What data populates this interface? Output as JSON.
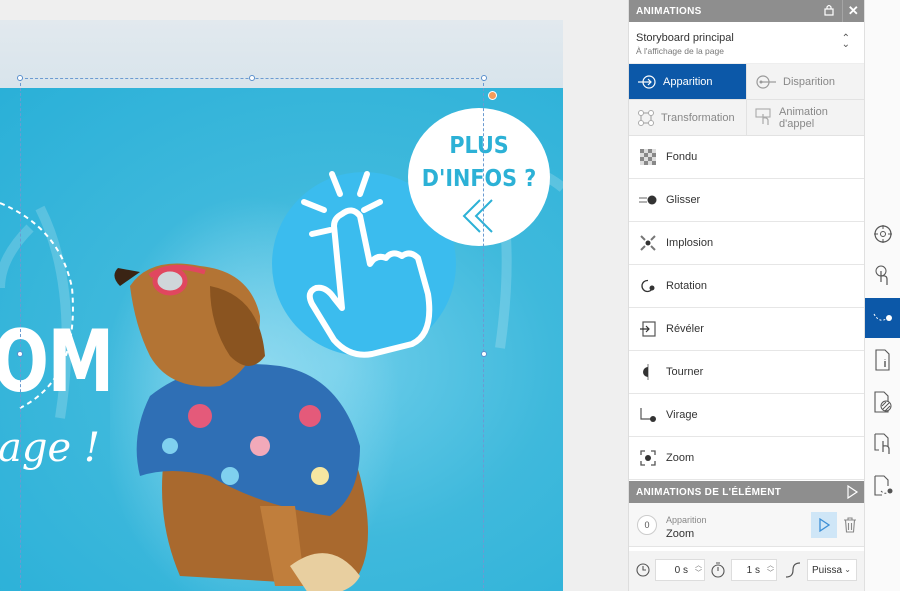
{
  "canvas": {
    "headline": "OM",
    "script_line": "age !",
    "info_bubble": {
      "line1": "PLUS",
      "line2": "D'INFOS ?"
    }
  },
  "panel": {
    "title": "ANIMATIONS",
    "storyboard": {
      "name": "Storyboard principal",
      "trigger": "À l'affichage de la page"
    },
    "tabs": [
      {
        "label": "Apparition",
        "active": true
      },
      {
        "label": "Disparition",
        "active": false
      },
      {
        "label": "Transformation",
        "active": false
      },
      {
        "label_line1": "Animation",
        "label_line2": "d'appel",
        "active": false
      }
    ],
    "animations": [
      "Fondu",
      "Glisser",
      "Implosion",
      "Rotation",
      "Révéler",
      "Tourner",
      "Virage",
      "Zoom"
    ],
    "element_section": {
      "title": "ANIMATIONS DE L'ÉLÉMENT",
      "item": {
        "index": "0",
        "type": "Apparition",
        "name": "Zoom"
      },
      "delay": "0 s",
      "duration": "1 s",
      "easing": "Puissa"
    }
  },
  "toolbar": {
    "icons": [
      "target-icon",
      "tap-hand-icon",
      "motion-path-icon",
      "page-info-icon",
      "layer-texture-icon",
      "page-touch-icon",
      "page-motion-icon"
    ],
    "active_index": 2
  },
  "colors": {
    "accent": "#0c58a8",
    "banner": "#2ab0d8",
    "header": "#8e8e8e"
  }
}
